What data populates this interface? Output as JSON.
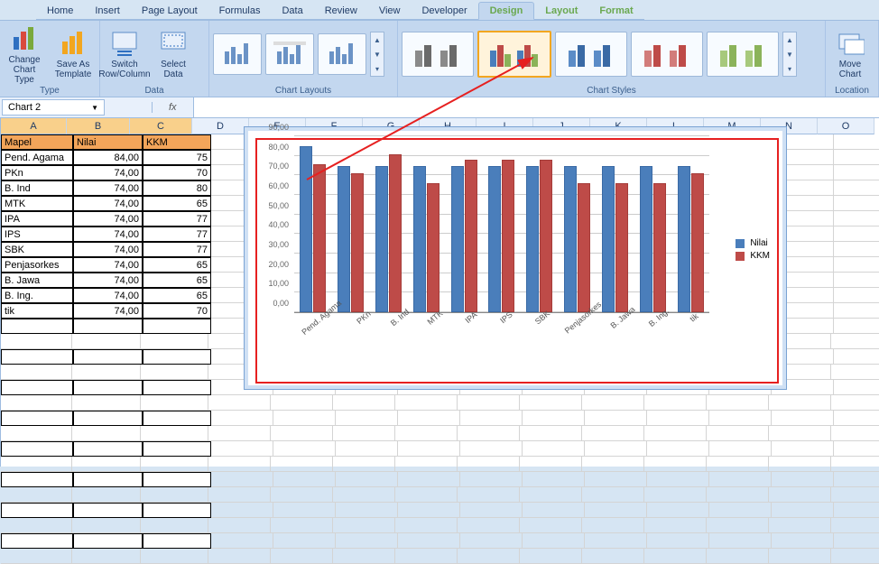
{
  "tabs": {
    "home": "Home",
    "insert": "Insert",
    "pageLayout": "Page Layout",
    "formulas": "Formulas",
    "data": "Data",
    "review": "Review",
    "view": "View",
    "developer": "Developer",
    "design": "Design",
    "layout": "Layout",
    "format": "Format"
  },
  "ribbon": {
    "changeChartType": "Change Chart Type",
    "saveAsTemplate": "Save As Template",
    "typeGroup": "Type",
    "switchRowCol": "Switch Row/Column",
    "selectData": "Select Data",
    "dataGroup": "Data",
    "chartLayoutsGroup": "Chart Layouts",
    "chartStylesGroup": "Chart Styles",
    "moveChart": "Move Chart",
    "locationGroup": "Location"
  },
  "namebox": "Chart 2",
  "fx": "fx",
  "columns": [
    "A",
    "B",
    "C",
    "D",
    "E",
    "F",
    "G",
    "H",
    "I",
    "J",
    "K",
    "L",
    "M",
    "N",
    "O"
  ],
  "table": {
    "headers": {
      "mapel": "Mapel",
      "nilai": "Nilai",
      "kkm": "KKM"
    },
    "rows": [
      {
        "mapel": "Pend. Agama",
        "nilai": "84,00",
        "kkm": "75"
      },
      {
        "mapel": "PKn",
        "nilai": "74,00",
        "kkm": "70"
      },
      {
        "mapel": "B. Ind",
        "nilai": "74,00",
        "kkm": "80"
      },
      {
        "mapel": "MTK",
        "nilai": "74,00",
        "kkm": "65"
      },
      {
        "mapel": "IPA",
        "nilai": "74,00",
        "kkm": "77"
      },
      {
        "mapel": "IPS",
        "nilai": "74,00",
        "kkm": "77"
      },
      {
        "mapel": "SBK",
        "nilai": "74,00",
        "kkm": "77"
      },
      {
        "mapel": "Penjasorkes",
        "nilai": "74,00",
        "kkm": "65"
      },
      {
        "mapel": "B. Jawa",
        "nilai": "74,00",
        "kkm": "65"
      },
      {
        "mapel": "B. Ing.",
        "nilai": "74,00",
        "kkm": "65"
      },
      {
        "mapel": "tik",
        "nilai": "74,00",
        "kkm": "70"
      }
    ]
  },
  "chart_data": {
    "type": "bar",
    "categories": [
      "Pend. Agama",
      "PKn",
      "B. Ind",
      "MTK",
      "IPA",
      "IPS",
      "SBK",
      "Penjasorkes",
      "B. Jawa",
      "B. Ing.",
      "tik"
    ],
    "series": [
      {
        "name": "Nilai",
        "values": [
          84,
          74,
          74,
          74,
          74,
          74,
          74,
          74,
          74,
          74,
          74
        ]
      },
      {
        "name": "KKM",
        "values": [
          75,
          70,
          80,
          65,
          77,
          77,
          77,
          65,
          65,
          65,
          70
        ]
      }
    ],
    "ylim": [
      0,
      90
    ],
    "yticks": [
      "0,00",
      "10,00",
      "20,00",
      "30,00",
      "40,00",
      "50,00",
      "60,00",
      "70,00",
      "80,00",
      "90,00"
    ]
  }
}
